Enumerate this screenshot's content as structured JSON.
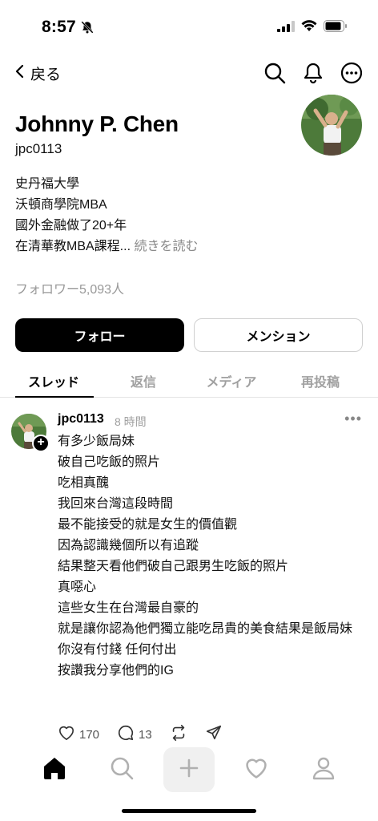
{
  "status": {
    "time": "8:57"
  },
  "nav": {
    "back_label": "戻る"
  },
  "profile": {
    "name": "Johnny P. Chen",
    "handle": "jpc0113",
    "bio_lines": [
      "史丹福大學",
      "沃頓商學院MBA",
      "國外金融做了20+年",
      "在清華教MBA課程..."
    ],
    "bio_more": "続きを読む",
    "followers": "フォロワー5,093人"
  },
  "buttons": {
    "follow": "フォロー",
    "mention": "メンション"
  },
  "tabs": [
    "スレッド",
    "返信",
    "メディア",
    "再投稿"
  ],
  "post": {
    "user": "jpc0113",
    "time": "8 時間",
    "more": "•••",
    "lines": [
      "有多少飯局妹",
      "破自己吃飯的照片",
      "吃相真醜",
      "我回來台灣這段時間",
      "最不能接受的就是女生的價值觀",
      "因為認識幾個所以有追蹤",
      "結果整天看他們破自己跟男生吃飯的照片",
      "真噁心",
      "這些女生在台灣最自豪的",
      "就是讓你認為他們獨立能吃昂貴的美食結果是飯局妹",
      "你沒有付錢 任何付出",
      "按讚我分享他們的IG"
    ],
    "likes": "170",
    "comments": "13"
  },
  "colors": {
    "accent": "#000000",
    "muted": "#a0a0a0"
  }
}
